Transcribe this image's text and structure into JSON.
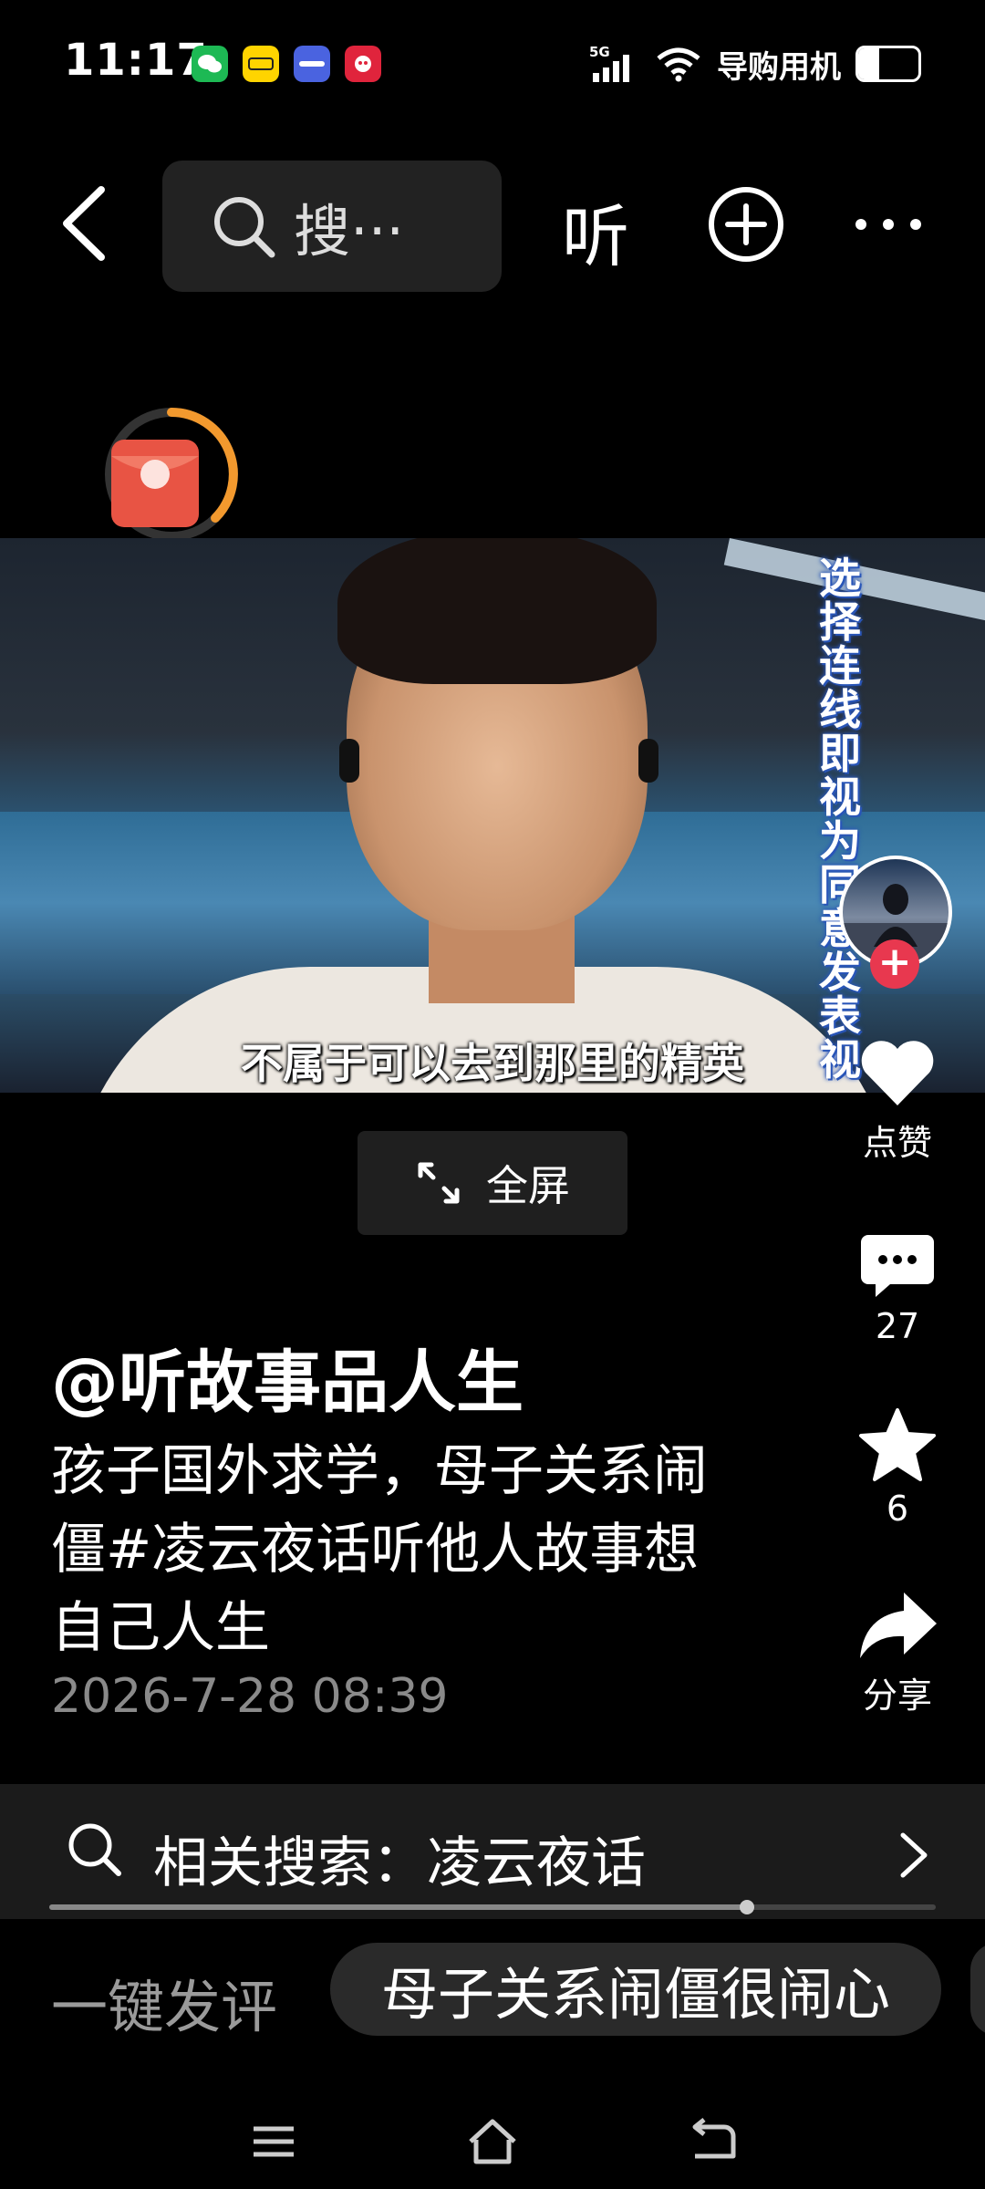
{
  "status_bar": {
    "time": "11:17",
    "network": "5G",
    "carrier": "导购用机",
    "battery_level": 0.35,
    "app_icons": [
      "wechat-icon",
      "xianyu-icon",
      "vivo-icon",
      "pinduoduo-icon"
    ]
  },
  "top_nav": {
    "search_placeholder": "搜···",
    "listen_label": "听"
  },
  "video": {
    "subtitle": "不属于可以去到那里的精英",
    "vertical_caption": "选择连线即视为同意发表视"
  },
  "fullscreen": {
    "label": "全屏"
  },
  "right_rail": {
    "like_label": "点赞",
    "comment_count": "27",
    "favorite_count": "6",
    "share_label": "分享"
  },
  "post": {
    "author": "@听故事品人生",
    "description": "孩子国外求学，母子关系闹僵#凌云夜话听他人故事想自己人生",
    "date": "2026-7-28 08:39"
  },
  "related_search": {
    "text": "相关搜索：凌云夜话"
  },
  "playback_progress": 0.787,
  "quick_comment": {
    "label": "一键发评",
    "suggestion": "母子关系闹僵很闹心"
  },
  "colors": {
    "accent_red": "#e8384f",
    "timer_orange": "#f2992e",
    "background": "#000000"
  }
}
